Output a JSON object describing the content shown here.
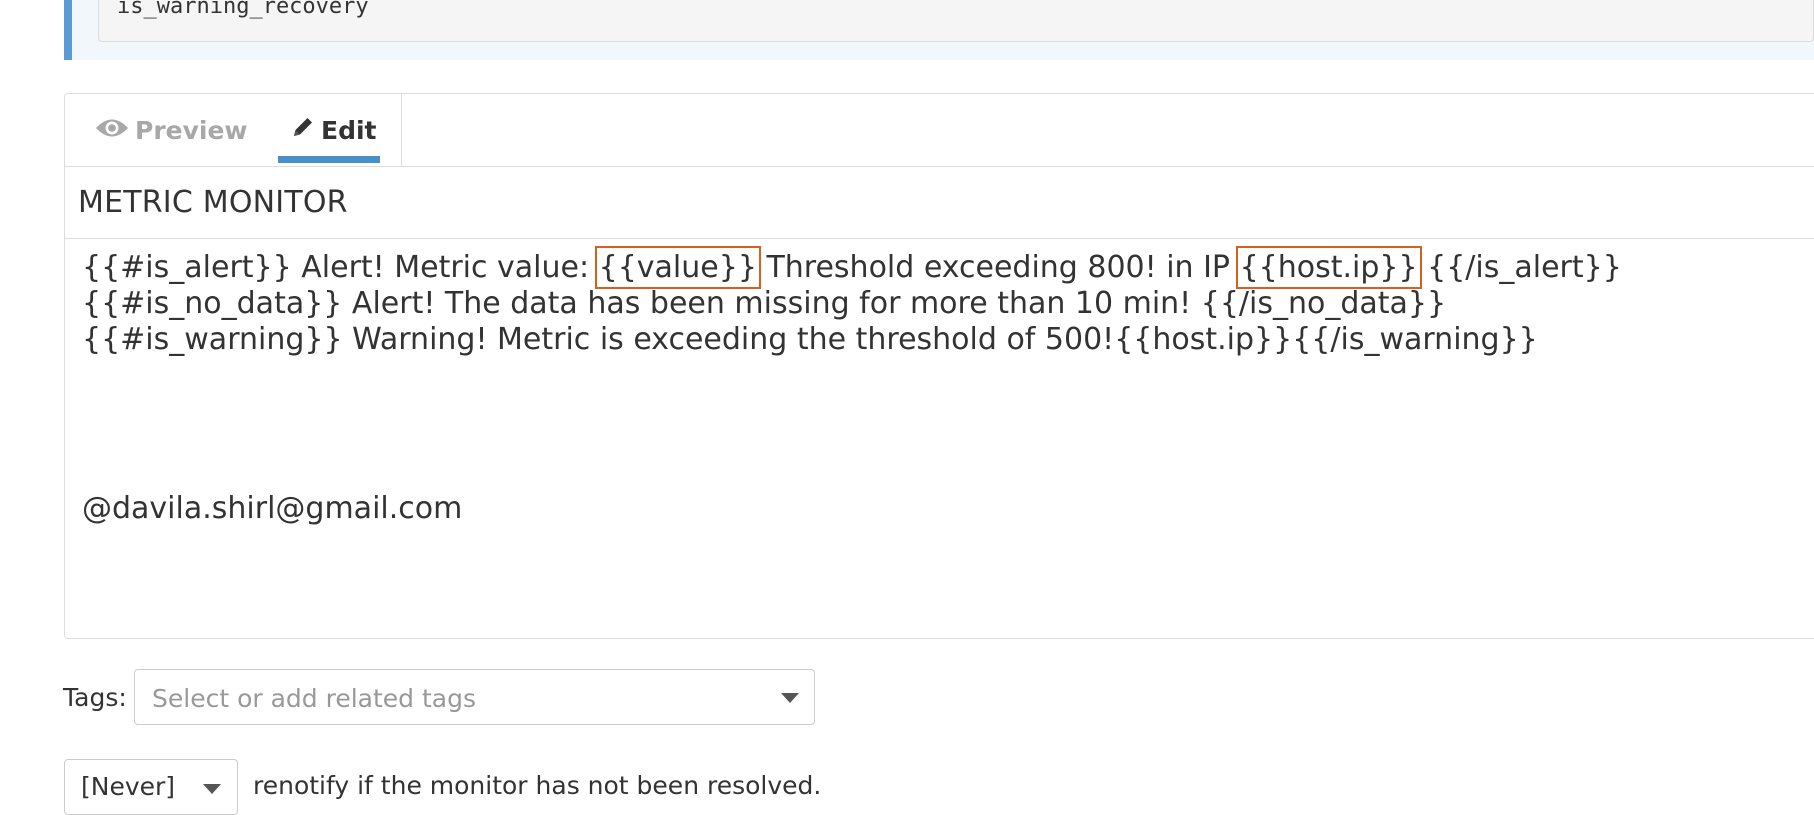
{
  "code_block": {
    "text": "is_warning_recovery"
  },
  "tabs": {
    "preview_label": "Preview",
    "edit_label": "Edit"
  },
  "editor": {
    "title": "METRIC MONITOR",
    "line1_a": "{{#is_alert}} Alert! Metric value: ",
    "line1_value": "{{value}}",
    "line1_b": " Threshold exceeding 800! in IP ",
    "line1_host": "{{host.ip}}",
    "line1_c": " {{/is_alert}}",
    "line2": "{{#is_no_data}} Alert! The data has been missing for more than 10 min! {{/is_no_data}}",
    "line3": "{{#is_warning}} Warning! Metric is exceeding the threshold of 500!{{host.ip}}{{/is_warning}}",
    "mention": "@davila.shirl@gmail.com"
  },
  "tags": {
    "label": "Tags:",
    "placeholder": "Select or add related tags"
  },
  "renotify": {
    "value": "[Never]",
    "text": "renotify if the monitor has not been resolved."
  },
  "colors": {
    "accent": "#4a90c8",
    "highlight": "#d9601a",
    "callout_border": "#5b9bd5"
  },
  "icons": {
    "preview": "eye-icon",
    "edit": "pencil-icon"
  }
}
